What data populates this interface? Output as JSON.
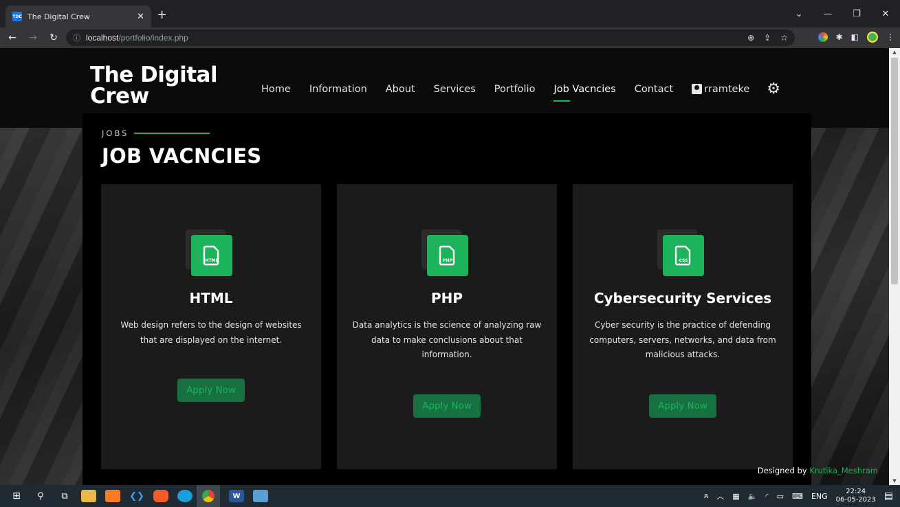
{
  "browser": {
    "tab_title": "The Digital Crew",
    "favicon_text": "TDC",
    "url_host": "localhost",
    "url_path": "/portfolio/index.php"
  },
  "site": {
    "brand_line1": "The Digital",
    "brand_line2": "Crew",
    "nav": [
      "Home",
      "Information",
      "About",
      "Services",
      "Portfolio",
      "Job Vacncies",
      "Contact"
    ],
    "active_nav": "Job Vacncies",
    "username": "rramteke"
  },
  "section": {
    "kicker": "JOBS",
    "title": "JOB VACNCIES"
  },
  "jobs": [
    {
      "file_label": "HTML",
      "title": "HTML",
      "description": "Web design refers to the design of websites that are displayed on the internet.",
      "button": "Apply Now"
    },
    {
      "file_label": "PHP",
      "title": "PHP",
      "description": "Data analytics is the science of analyzing raw data to make conclusions about that information.",
      "button": "Apply Now"
    },
    {
      "file_label": "CSS",
      "title": "Cybersecurity Services",
      "description": "Cyber security is the practice of defending computers, servers, networks, and data from malicious attacks.",
      "button": "Apply Now"
    }
  ],
  "footer": {
    "designed_by": "Designed by",
    "author": "Krutika_Meshram"
  },
  "taskbar": {
    "language": "ENG",
    "time": "22:24",
    "date": "06-05-2023"
  },
  "colors": {
    "accent": "#1cb35a",
    "button_bg": "#16703f",
    "card_bg": "#1b1b1b"
  }
}
